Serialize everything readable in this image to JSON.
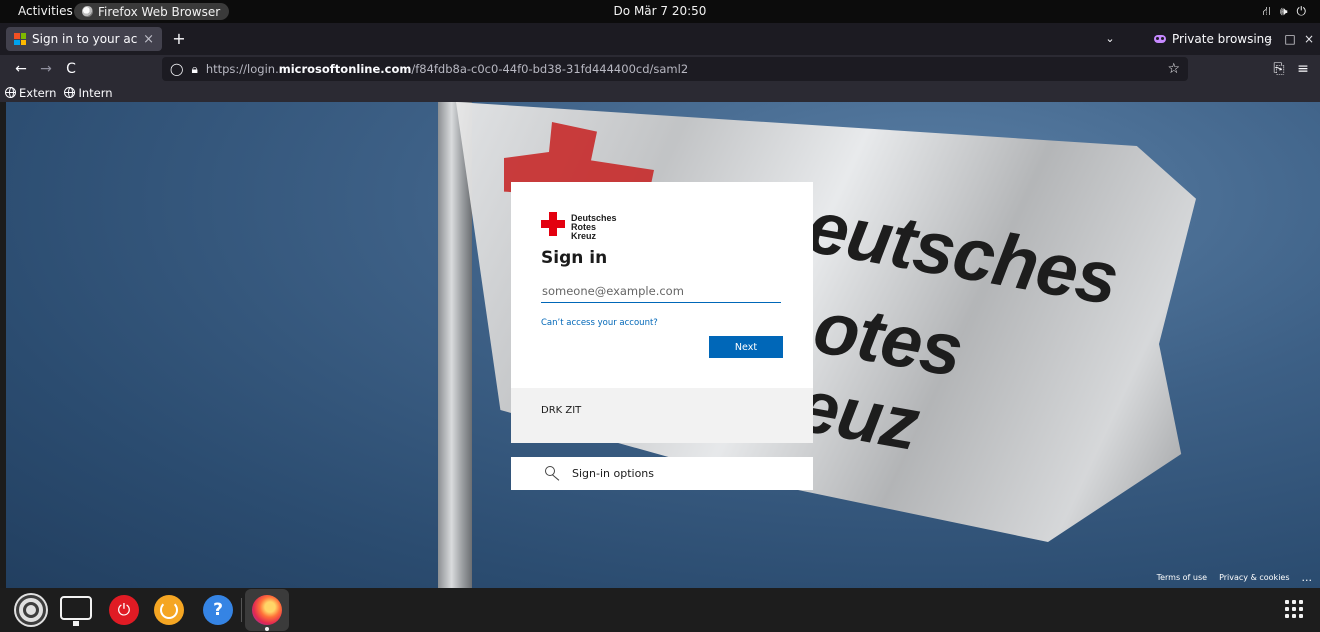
{
  "topbar": {
    "activities": "Activities",
    "app_name": "Firefox Web Browser",
    "clock": "Do Mär 7  20:50",
    "tray_network": "⛙",
    "tray_volume": "🕪",
    "tray_power": "⏻"
  },
  "browser": {
    "tab_title": "Sign in to your account",
    "tab_close": "×",
    "new_tab": "+",
    "tab_list": "⌄",
    "private_label": "Private browsing",
    "minimize": "–",
    "maximize": "□",
    "close": "×",
    "back": "←",
    "forward": "→",
    "reload": "C",
    "url_prefix": "https://login.",
    "url_domain": "microsoftonline.com",
    "url_path": "/f84fdb8a-c0c0-44f0-bd38-31fd444400cd/saml2",
    "star": "☆",
    "extensions": "⎘",
    "menu": "≡",
    "bookmarks": [
      "Extern",
      "Intern"
    ]
  },
  "page": {
    "flag_text": [
      "eutsches",
      "otes",
      "euz"
    ],
    "logo_words": [
      "Deutsches",
      "Rotes",
      "Kreuz"
    ],
    "signin_title": "Sign in",
    "email_placeholder": "someone@example.com",
    "email_value": "",
    "cant_access": "Can’t access your account?",
    "next_label": "Next",
    "org_name": "DRK ZIT",
    "signin_options": "Sign-in options",
    "footer": {
      "terms": "Terms of use",
      "privacy": "Privacy & cookies",
      "more": "..."
    }
  },
  "dock": {
    "help_glyph": "?",
    "power_glyph": "⏻"
  },
  "colors": {
    "ms_blue": "#0067b8",
    "drk_red": "#e3000f",
    "ms_logo": [
      "#f25022",
      "#7fba00",
      "#00a4ef",
      "#ffb900"
    ]
  }
}
